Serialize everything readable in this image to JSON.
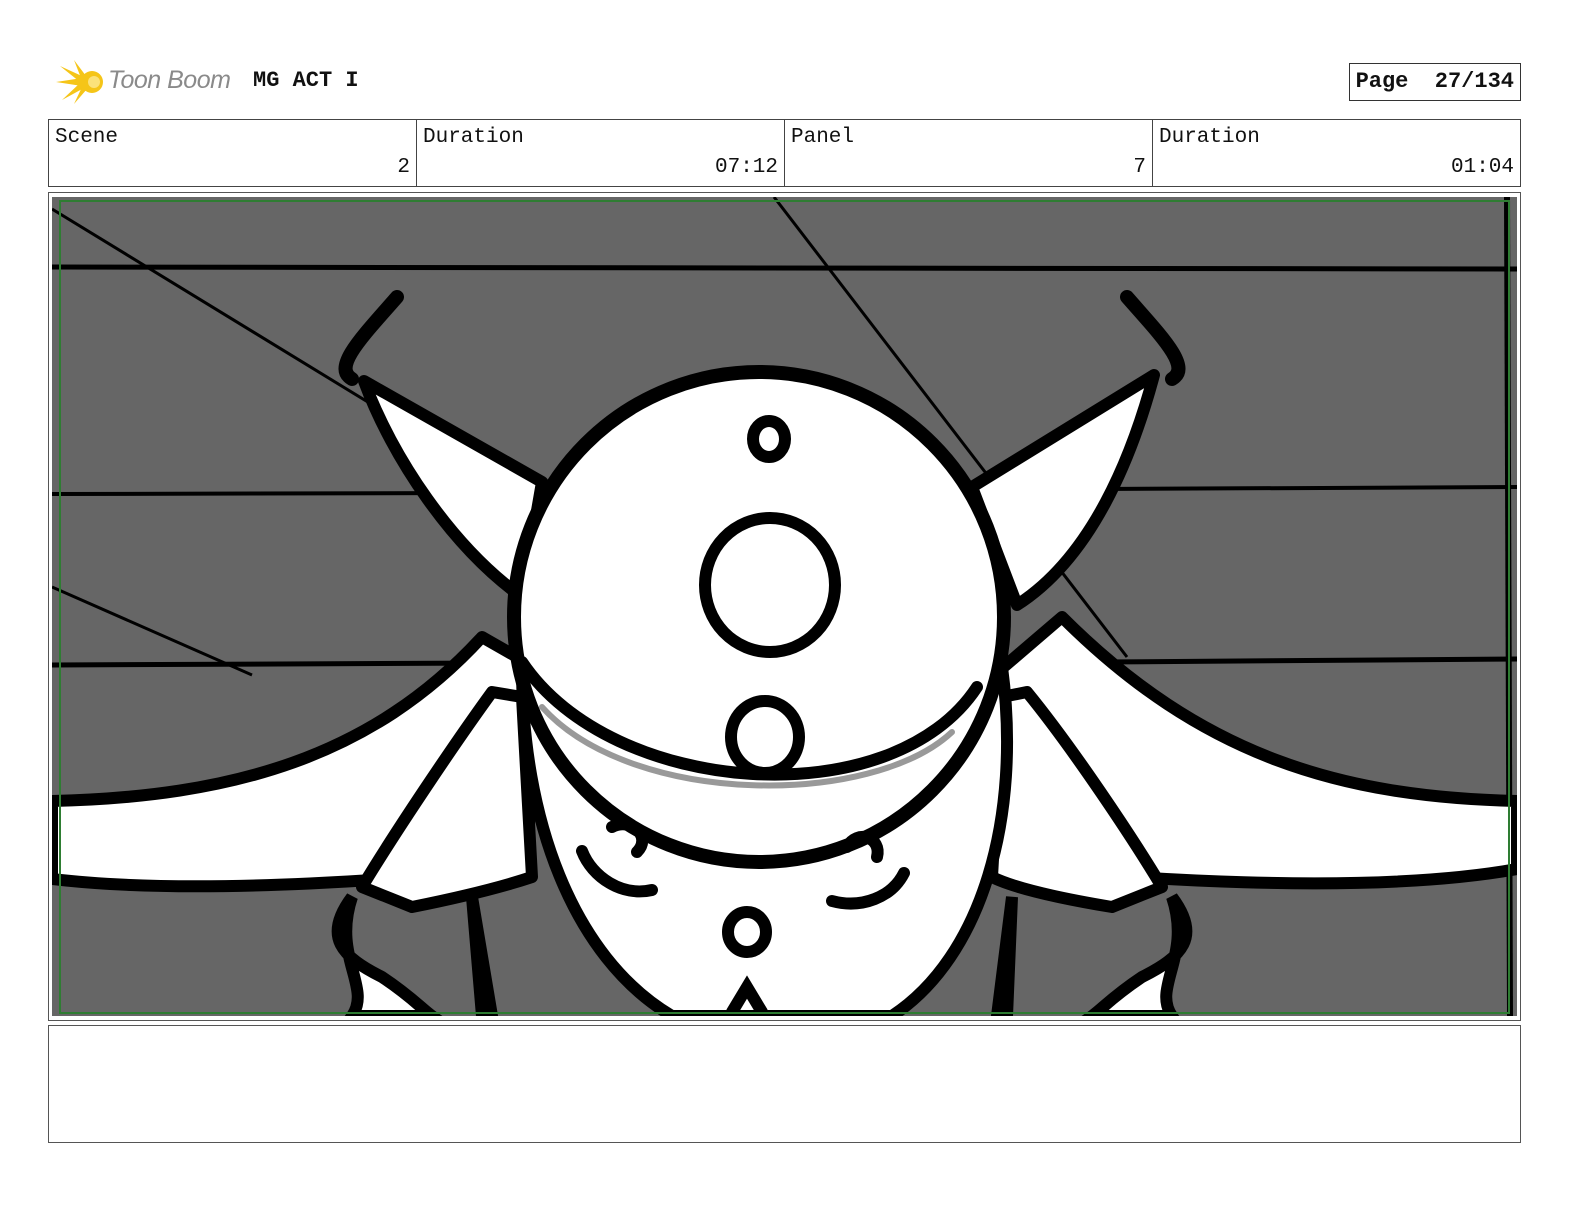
{
  "header": {
    "logo_text": "Toon Boom",
    "project_title": "MG ACT I",
    "page_label": "Page",
    "page_number": "27/134"
  },
  "info": {
    "scene_label": "Scene",
    "scene_value": "2",
    "scene_duration_label": "Duration",
    "scene_duration_value": "07:12",
    "panel_label": "Panel",
    "panel_value": "7",
    "panel_duration_label": "Duration",
    "panel_duration_value": "01:04"
  },
  "panel": {
    "background_color": "#666666",
    "line_color": "#000000",
    "safe_frame_color": "#2e7d32"
  },
  "notes": {
    "text": ""
  }
}
